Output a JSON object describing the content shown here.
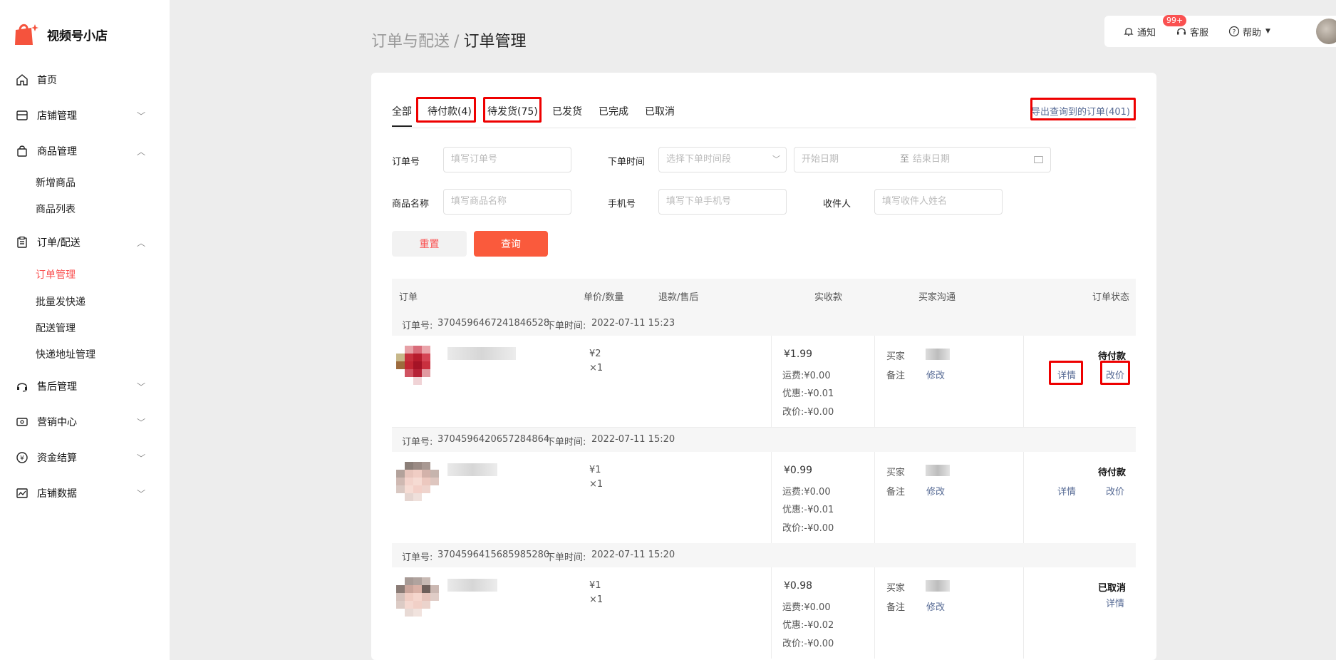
{
  "app": {
    "name": "视频号小店"
  },
  "sidebar": {
    "items": [
      {
        "label": "首页",
        "icon": "home-icon"
      },
      {
        "label": "店铺管理",
        "icon": "store-icon"
      },
      {
        "label": "商品管理",
        "icon": "bag-icon"
      },
      {
        "label": "订单/配送",
        "icon": "clipboard-icon"
      },
      {
        "label": "售后管理",
        "icon": "headset-icon"
      },
      {
        "label": "营销中心",
        "icon": "ticket-icon"
      },
      {
        "label": "资金结算",
        "icon": "yen-icon"
      },
      {
        "label": "店铺数据",
        "icon": "chart-icon"
      }
    ],
    "product_sub": [
      "新增商品",
      "商品列表"
    ],
    "order_sub": [
      "订单管理",
      "批量发快递",
      "配送管理",
      "快递地址管理"
    ],
    "active_sub": "订单管理"
  },
  "breadcrumb": {
    "parent": "订单与配送",
    "sep": "/",
    "current": "订单管理"
  },
  "toolbar": {
    "notify": "通知",
    "badge": "99+",
    "service": "客服",
    "help": "帮助"
  },
  "tabs": [
    {
      "label": "全部",
      "active": true
    },
    {
      "label": "待付款(4)",
      "highlighted": true
    },
    {
      "label": "待发货(75)",
      "highlighted": true
    },
    {
      "label": "已发货"
    },
    {
      "label": "已完成"
    },
    {
      "label": "已取消"
    }
  ],
  "export": "导出查询到的订单(401)",
  "filters": {
    "order_no": {
      "label": "订单号",
      "placeholder": "填写订单号"
    },
    "order_time": {
      "label": "下单时间",
      "placeholder": "选择下单时间段"
    },
    "date_start": "开始日期",
    "date_to": "至",
    "date_end": "结束日期",
    "product_name": {
      "label": "商品名称",
      "placeholder": "填写商品名称"
    },
    "phone": {
      "label": "手机号",
      "placeholder": "填写下单手机号"
    },
    "receiver": {
      "label": "收件人",
      "placeholder": "填写收件人姓名"
    }
  },
  "buttons": {
    "reset": "重置",
    "search": "查询"
  },
  "table": {
    "headers": [
      "订单",
      "单价/数量",
      "退款/售后",
      "实收款",
      "买家沟通",
      "订单状态"
    ],
    "orders": [
      {
        "no_label": "订单号:",
        "no": "3704596467241846528",
        "time_label": "下单时间:",
        "time": "2022-07-11 15:23",
        "price": "¥2",
        "qty": "×1",
        "paid": "¥1.99",
        "shipping": "运费:¥0.00",
        "discount": "优惠:-¥0.01",
        "adjust": "改价:-¥0.00",
        "buyer_label": "买家",
        "note_label": "备注",
        "edit": "修改",
        "status": "待付款",
        "detail": "详情",
        "change_price": "改价"
      },
      {
        "no_label": "订单号:",
        "no": "3704596420657284864",
        "time_label": "下单时间:",
        "time": "2022-07-11 15:20",
        "price": "¥1",
        "qty": "×1",
        "paid": "¥0.99",
        "shipping": "运费:¥0.00",
        "discount": "优惠:-¥0.01",
        "adjust": "改价:-¥0.00",
        "buyer_label": "买家",
        "note_label": "备注",
        "edit": "修改",
        "status": "待付款",
        "detail": "详情",
        "change_price": "改价"
      },
      {
        "no_label": "订单号:",
        "no": "3704596415685985280",
        "time_label": "下单时间:",
        "time": "2022-07-11 15:20",
        "price": "¥1",
        "qty": "×1",
        "paid": "¥0.98",
        "shipping": "运费:¥0.00",
        "discount": "优惠:-¥0.02",
        "adjust": "改价:-¥0.00",
        "buyer_label": "买家",
        "note_label": "备注",
        "edit": "修改",
        "status": "已取消",
        "detail": "详情"
      }
    ]
  },
  "colors": {
    "accent": "#fa5151",
    "link": "#576b95",
    "highlight": "#e00000",
    "search_button": "#fa5a3c"
  }
}
